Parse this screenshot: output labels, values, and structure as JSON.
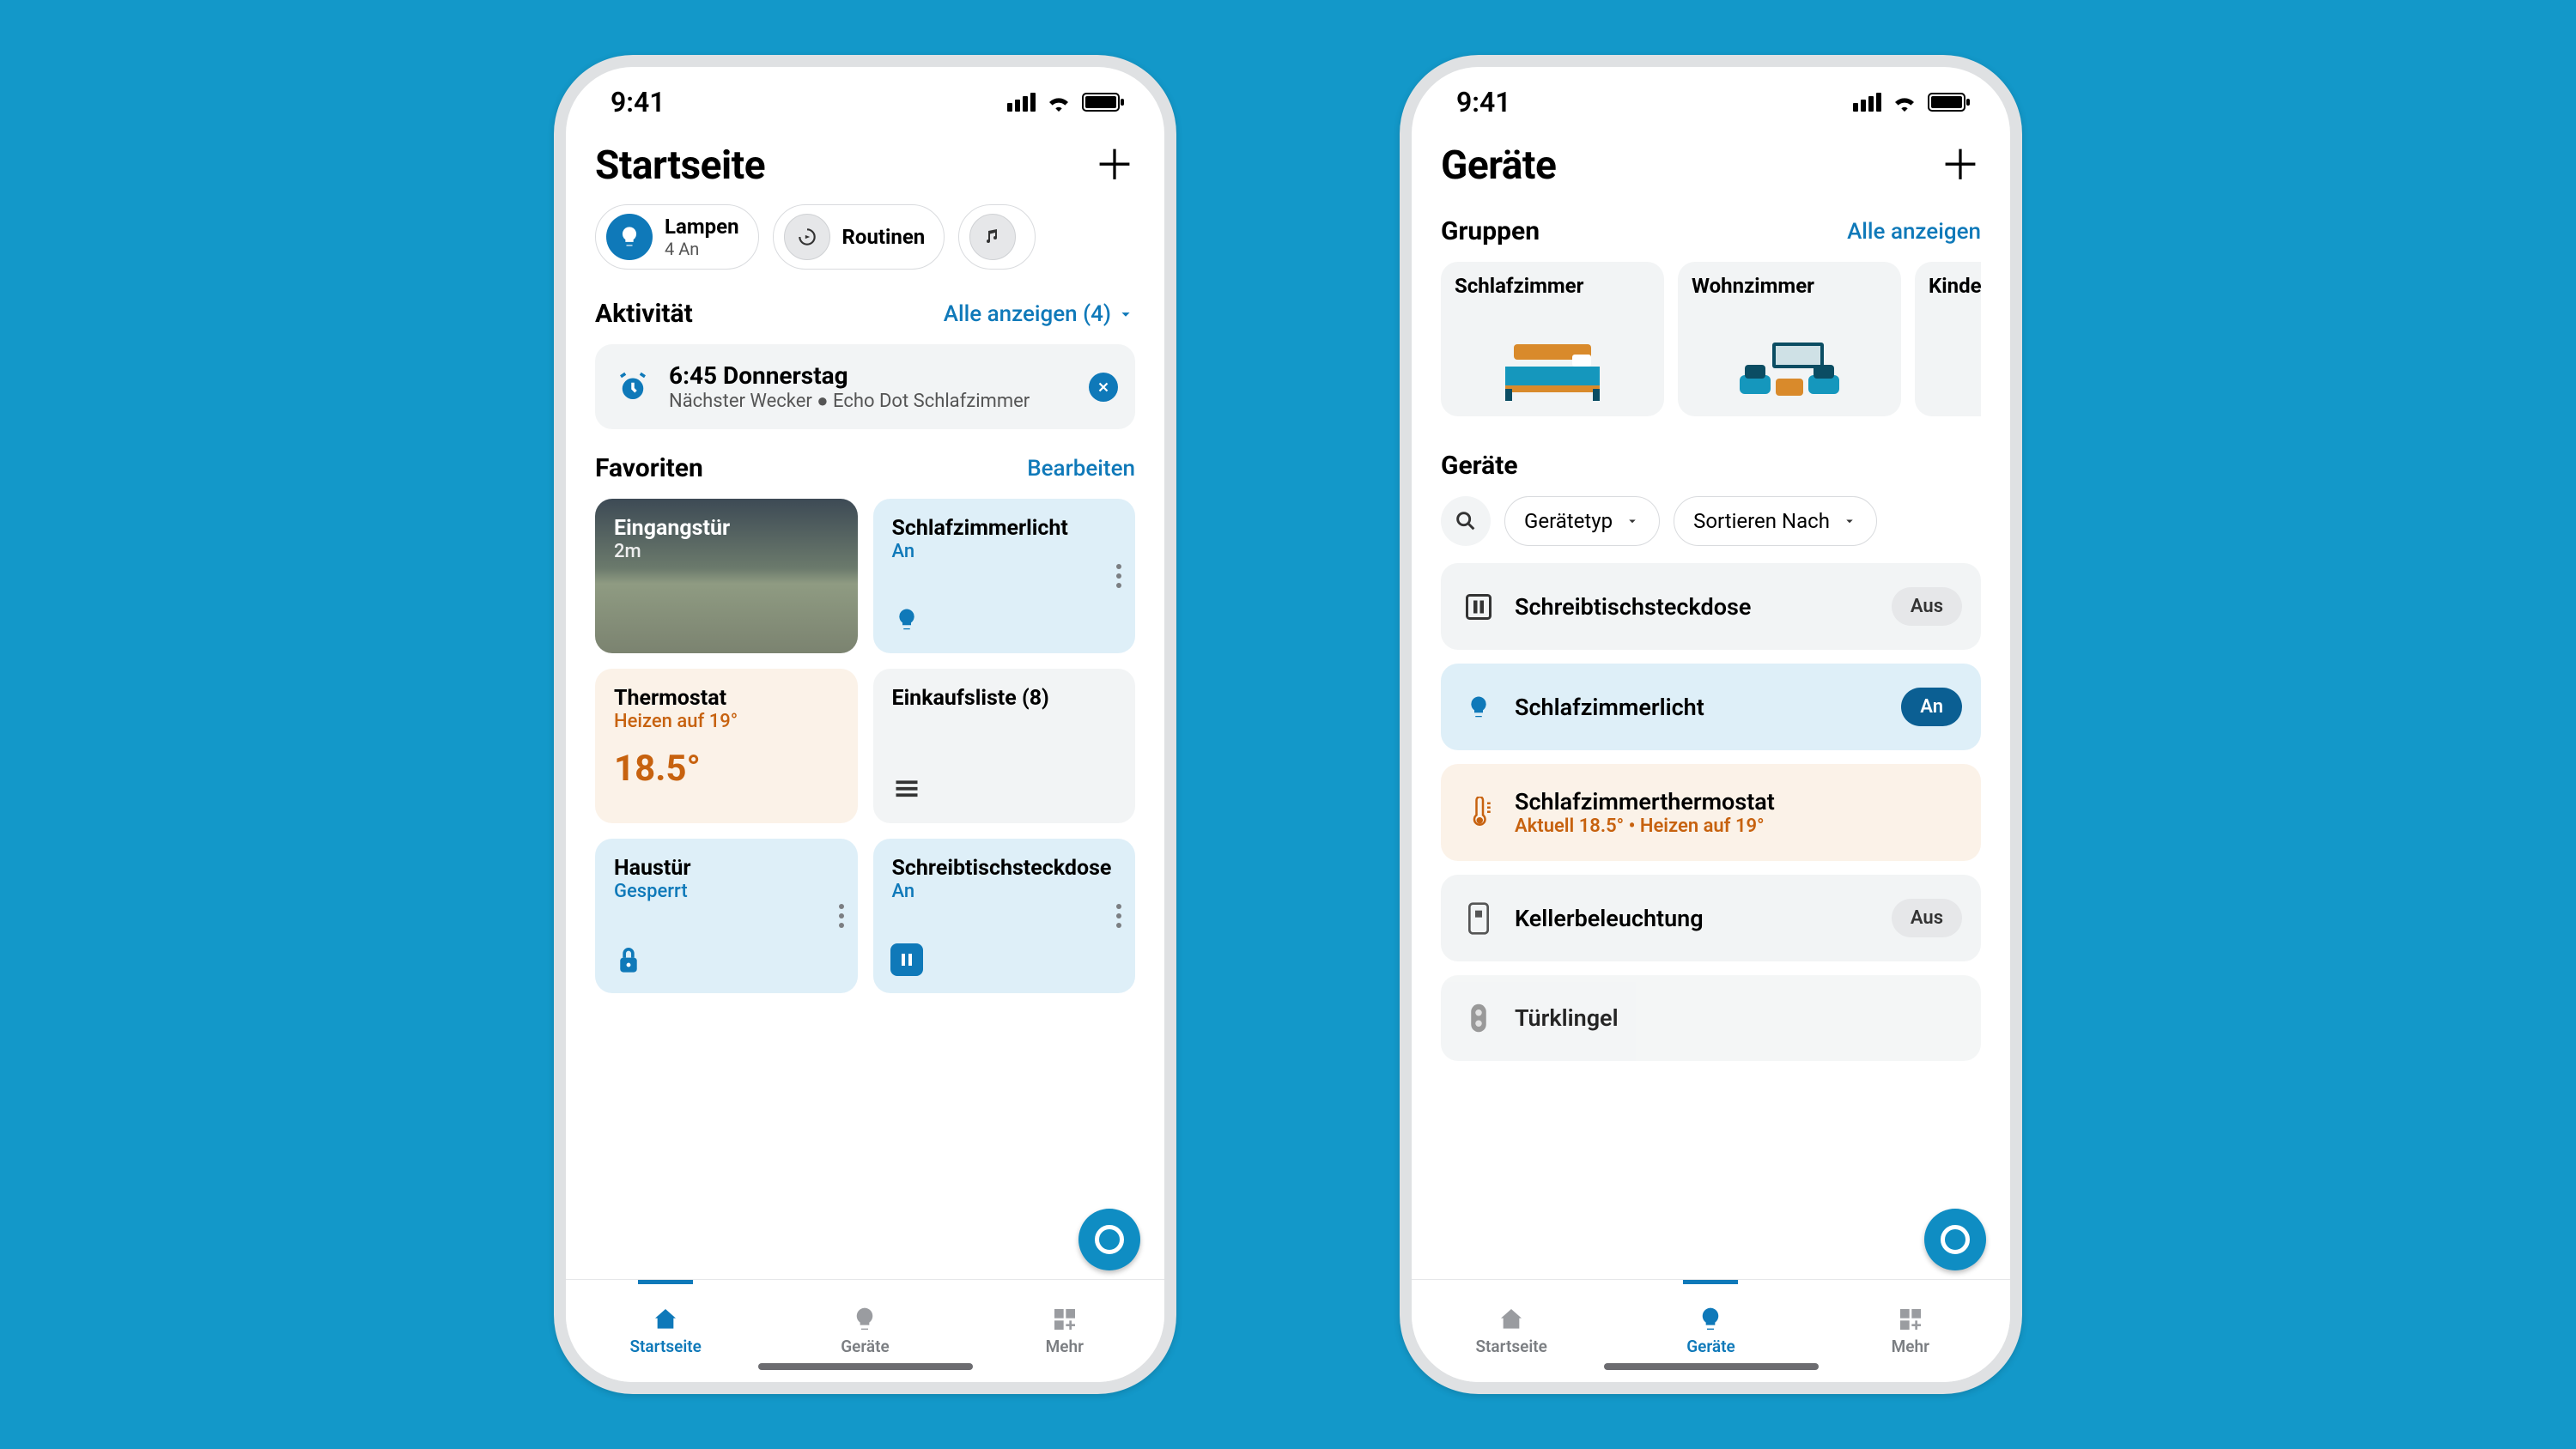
{
  "statusbar": {
    "time": "9:41"
  },
  "nav": {
    "home": "Startseite",
    "devices": "Geräte",
    "more": "Mehr"
  },
  "home": {
    "title": "Startseite",
    "pills": {
      "lamps": {
        "label": "Lampen",
        "sub": "4 An"
      },
      "routines": {
        "label": "Routinen"
      }
    },
    "activity": {
      "heading": "Aktivität",
      "show_all": "Alle anzeigen (4)",
      "alarm": {
        "line1": "6:45 Donnerstag",
        "line2": "Nächster Wecker ● Echo Dot Schlafzimmer"
      }
    },
    "favorites": {
      "heading": "Favoriten",
      "edit": "Bearbeiten",
      "cards": {
        "doorcam": {
          "title": "Eingangstür",
          "sub": "2m"
        },
        "bedlight": {
          "title": "Schlafzimmerlicht",
          "sub": "An"
        },
        "thermo": {
          "title": "Thermostat",
          "sub": "Heizen auf 19°",
          "value": "18.5°"
        },
        "shopping": {
          "title": "Einkaufsliste (8)"
        },
        "frontdoor": {
          "title": "Haustür",
          "sub": "Gesperrt"
        },
        "desksocket": {
          "title": "Schreibtischsteckdose",
          "sub": "An"
        }
      }
    }
  },
  "devices": {
    "title": "Geräte",
    "groups": {
      "heading": "Gruppen",
      "show_all": "Alle anzeigen",
      "items": [
        {
          "name": "Schlafzimmer"
        },
        {
          "name": "Wohnzimmer"
        },
        {
          "name": "Kinderzimmer"
        }
      ]
    },
    "list": {
      "heading": "Geräte",
      "filter_type": "Gerätetyp",
      "sort": "Sortieren Nach",
      "items": [
        {
          "name": "Schreibtischsteckdose",
          "state": "Aus"
        },
        {
          "name": "Schlafzimmerlicht",
          "state": "An"
        },
        {
          "name": "Schlafzimmerthermostat",
          "sub": "Aktuell 18.5° • Heizen auf 19°"
        },
        {
          "name": "Kellerbeleuchtung",
          "state": "Aus"
        },
        {
          "name": "Türklingel"
        }
      ]
    }
  }
}
